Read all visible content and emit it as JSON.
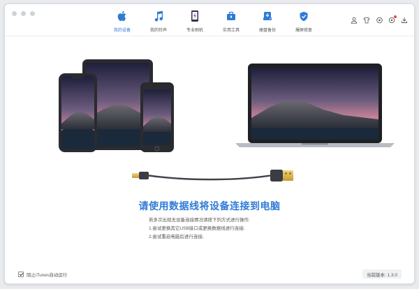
{
  "nav": {
    "tabs": [
      {
        "label": "我的设备",
        "icon": "apple-icon",
        "active": true
      },
      {
        "label": "我的铃声",
        "icon": "music-note-icon",
        "active": false
      },
      {
        "label": "专业刷机",
        "icon": "phone-flash-icon",
        "active": false
      },
      {
        "label": "实用工具",
        "icon": "toolbox-icon",
        "active": false
      },
      {
        "label": "硬盘备份",
        "icon": "backup-drive-icon",
        "active": false
      },
      {
        "label": "爆屏修复",
        "icon": "shield-check-icon",
        "active": false
      }
    ]
  },
  "toolbar": {
    "icons": [
      "user-icon",
      "shirt-icon",
      "eye-icon",
      "settings-icon",
      "download-icon"
    ],
    "accent": "#2f7bd6"
  },
  "main": {
    "headline": "请使用数据线将设备连接到电脑",
    "tips": [
      "若多次出现无设备连接情况请按下列方式进行操作:",
      "1.尝试更换其它USB接口或更换数据线进行连接;",
      "2.尝试重启电脑后进行连接;"
    ]
  },
  "footer": {
    "itunes_label": "阻止iTunes自动运行",
    "itunes_checked": true,
    "version_label": "当前版本: 1.3.0"
  }
}
